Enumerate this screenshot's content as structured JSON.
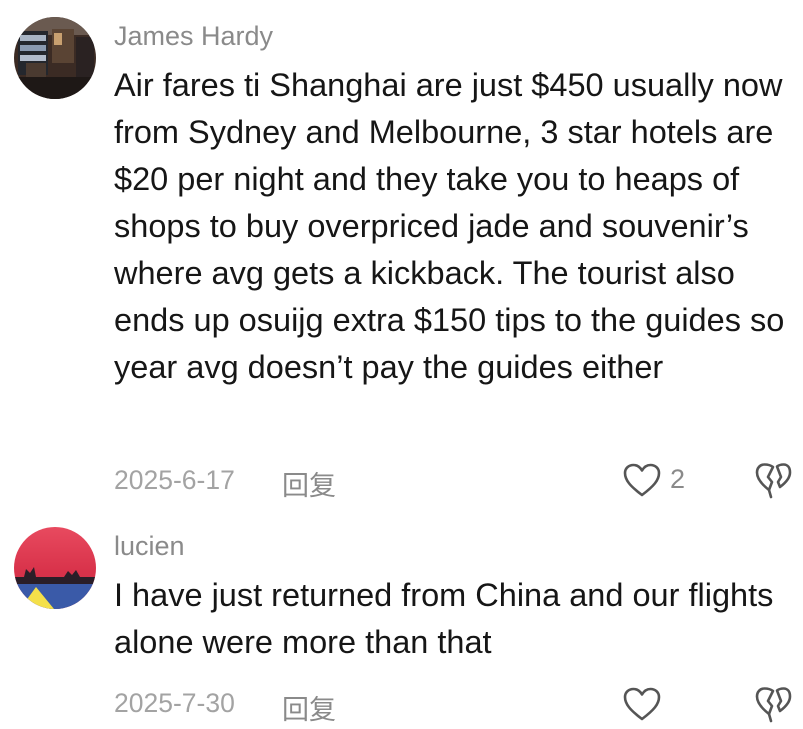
{
  "comments": [
    {
      "username": "James Hardy",
      "text": "Air fares ti Shanghai are just $450 usually now from Sydney and Melbourne, 3 star hotels are $20 per night and they take you to heaps of shops to buy overpriced jade and souvenir’s where avg gets a kickback. The tourist also ends up osuijg extra $150 tips to the guides so year avg doesn’t pay the guides either",
      "date": "2025-6-17",
      "reply_label": "回复",
      "like_count": "2"
    },
    {
      "username": "lucien",
      "text": "I have just returned from China and our flights alone were more than that",
      "date": "2025-7-30",
      "reply_label": "回复",
      "like_count": ""
    }
  ],
  "icons": {
    "like": "heart-outline-icon",
    "dislike": "broken-heart-outline-icon"
  },
  "colors": {
    "username": "#8a8a8a",
    "body_text": "#161616",
    "meta": "#a3a3a3",
    "icon": "#555555"
  }
}
